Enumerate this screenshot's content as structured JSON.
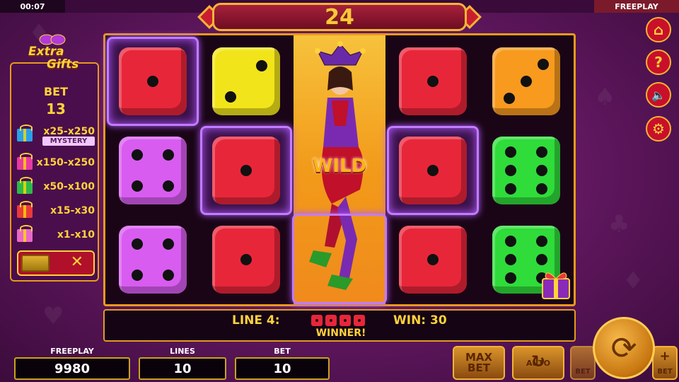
{
  "top": {
    "clock": "00:07",
    "mode": "FREEPLAY",
    "counter": "24"
  },
  "panel": {
    "logo": [
      "Extra",
      "Gifts"
    ],
    "bet_label": "BET",
    "bet_value": "13",
    "prizes": [
      {
        "range": "x25-x250",
        "tag": "MYSTERY",
        "color": "#2aa0e8"
      },
      {
        "range": "x150-x250",
        "color": "#e83aa0"
      },
      {
        "range": "x50-x100",
        "color": "#2fb84a"
      },
      {
        "range": "x15-x30",
        "color": "#e83a3a"
      },
      {
        "range": "x1-x10",
        "color": "#e868c8"
      }
    ],
    "toggle_icon": "✕"
  },
  "reels": {
    "wild_label": "WILD",
    "columns": [
      [
        {
          "color": "red",
          "pips": 1
        },
        {
          "color": "magenta",
          "pips": 4
        },
        {
          "color": "magenta",
          "pips": 4
        }
      ],
      [
        {
          "color": "yellow",
          "pips": 2
        },
        {
          "color": "red",
          "pips": 1
        },
        {
          "color": "red",
          "pips": 1
        }
      ],
      [],
      [
        {
          "color": "red",
          "pips": 1
        },
        {
          "color": "red",
          "pips": 1
        },
        {
          "color": "red",
          "pips": 1
        }
      ],
      [
        {
          "color": "orange",
          "pips": 3
        },
        {
          "color": "green",
          "pips": 6
        },
        {
          "color": "green",
          "pips": 6
        }
      ]
    ]
  },
  "status": {
    "line": "LINE 4:",
    "win": "WIN: 30",
    "winner": "WINNER!"
  },
  "bottom": {
    "freeplay_label": "FREEPLAY",
    "freeplay_value": "9980",
    "lines_label": "LINES",
    "lines_value": "10",
    "bet_label": "BET",
    "bet_value": "10",
    "max_bet": "MAX BET",
    "auto": "AUTO",
    "bet_minus": "BET",
    "bet_plus": "BET"
  },
  "side_icons": [
    "home-icon",
    "help-icon",
    "sound-off-icon",
    "settings-gear-icon"
  ]
}
